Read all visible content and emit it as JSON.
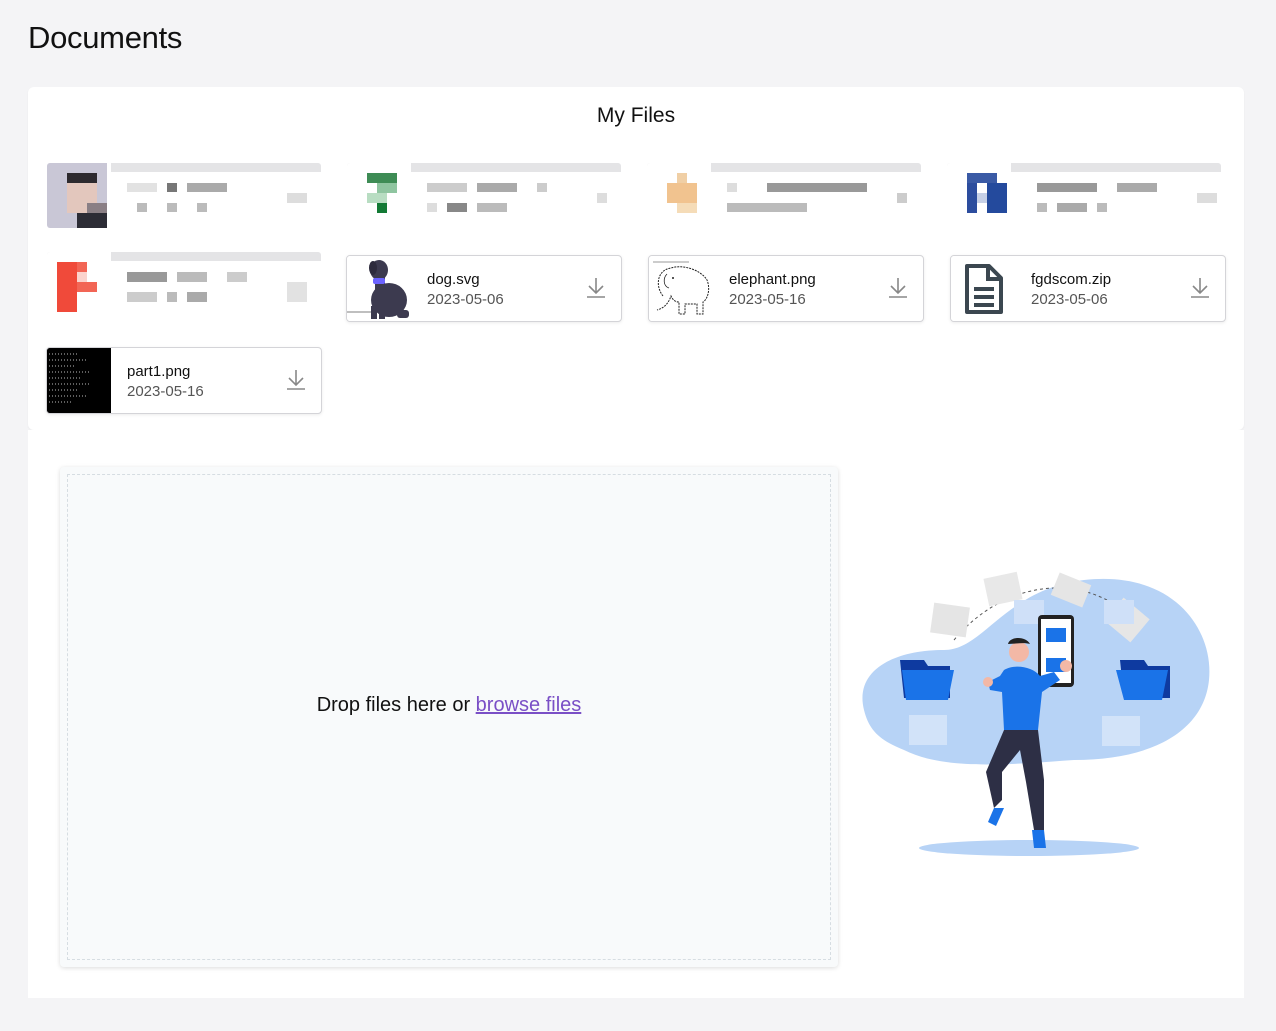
{
  "page": {
    "title": "Documents"
  },
  "files_panel": {
    "heading": "My Files",
    "files": [
      {
        "name": "dog.svg",
        "date": "2023-05-06",
        "thumb": "dog-thumbnail",
        "action_icon": "download-icon"
      },
      {
        "name": "elephant.png",
        "date": "2023-05-16",
        "thumb": "elephant-sketch-thumbnail",
        "action_icon": "download-icon"
      },
      {
        "name": "fgdscom.zip",
        "date": "2023-05-06",
        "thumb": "document-file-icon",
        "action_icon": "download-icon"
      },
      {
        "name": "part1.png",
        "date": "2023-05-16",
        "thumb": "terminal-screenshot-thumbnail",
        "action_icon": "download-icon"
      }
    ]
  },
  "upload": {
    "drop_text": "Drop files here or",
    "browse_label": "browse files",
    "link_color": "#7a4fc6"
  },
  "colors": {
    "accent_blue": "#1a73e8",
    "illustration_blob": "#b7d3f6"
  }
}
